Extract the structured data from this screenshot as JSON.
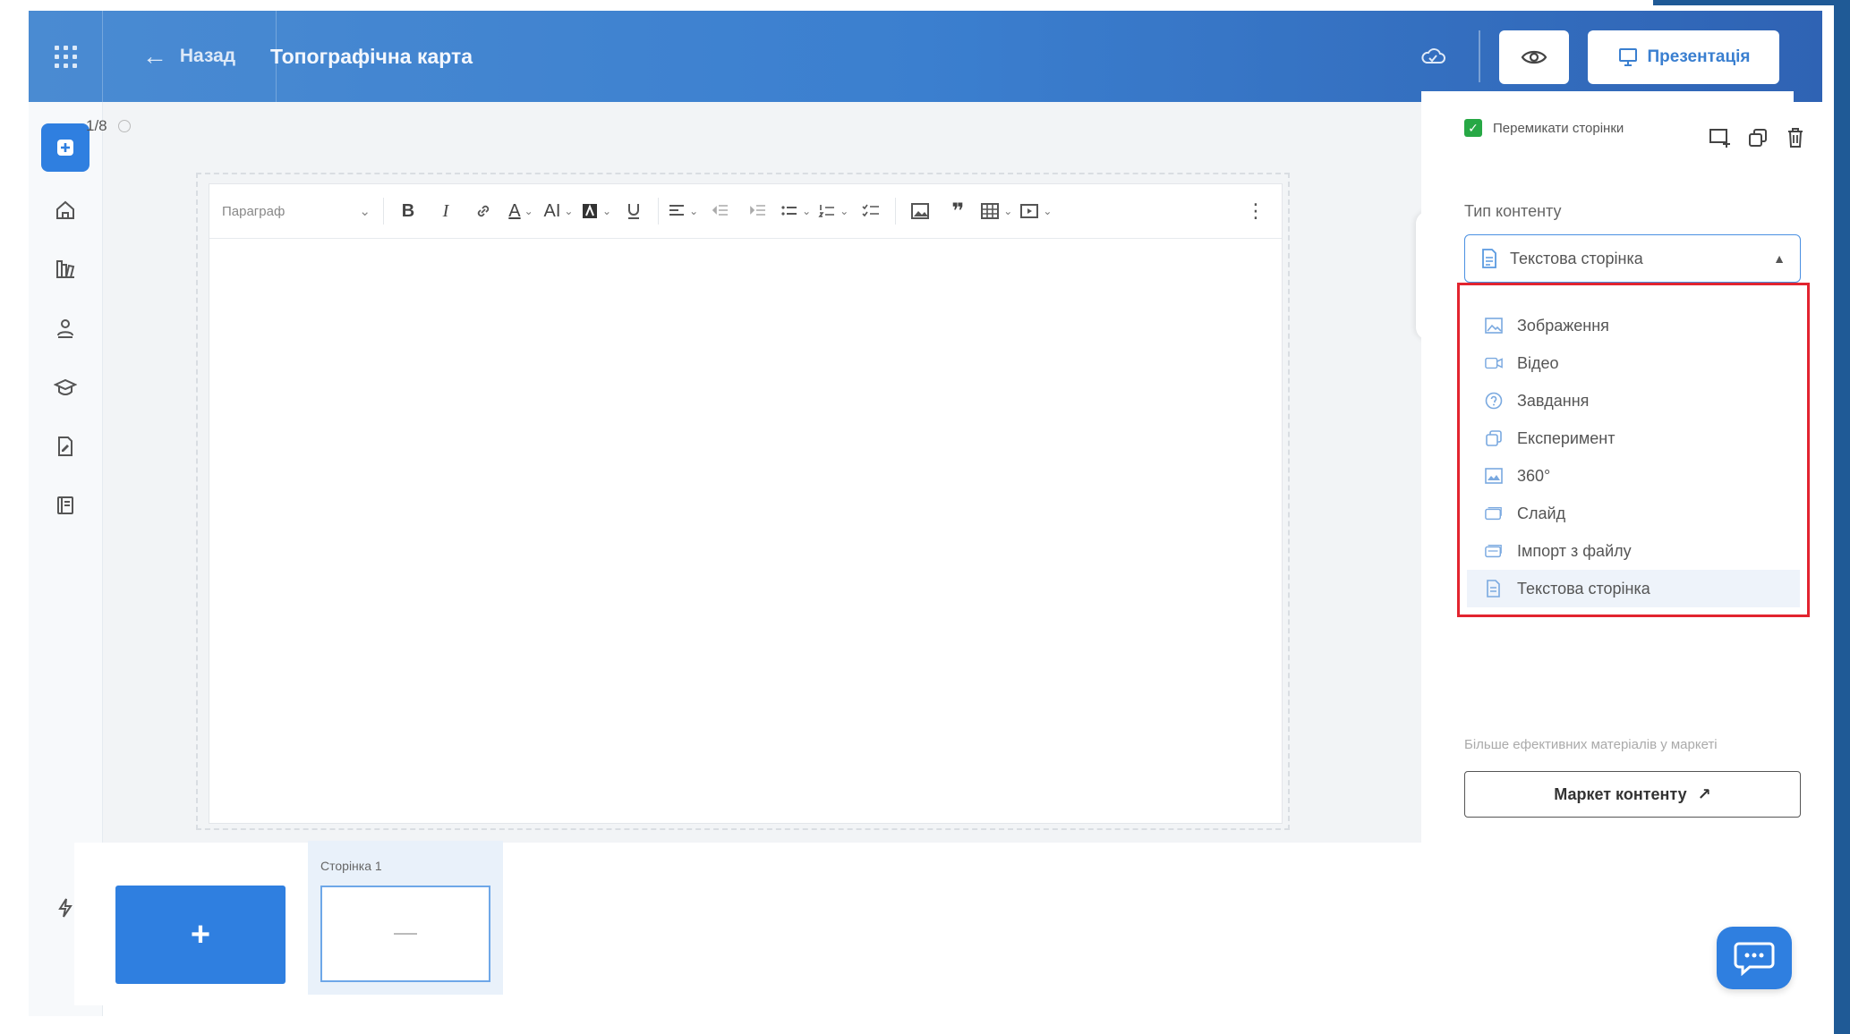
{
  "header": {
    "back_label": "Назад",
    "title": "Топографічна карта",
    "presentation_label": "Презентація"
  },
  "page_counter": "1/8",
  "toolbar": {
    "paragraph_label": "Параграф",
    "buttons": [
      "B",
      "I",
      "A",
      "AI"
    ]
  },
  "right_panel": {
    "switch_pages_label": "Перемикати сторінки",
    "content_type_label": "Тип контенту",
    "selected_type": "Текстова сторінка",
    "options": [
      {
        "label": "Зображення",
        "icon": "image-icon"
      },
      {
        "label": "Відео",
        "icon": "video-icon"
      },
      {
        "label": "Завдання",
        "icon": "question-icon"
      },
      {
        "label": "Експеримент",
        "icon": "experiment-icon"
      },
      {
        "label": "360°",
        "icon": "panorama-icon"
      },
      {
        "label": "Слайд",
        "icon": "slide-icon"
      },
      {
        "label": "Імпорт з файлу",
        "icon": "import-icon"
      },
      {
        "label": "Текстова сторінка",
        "icon": "text-page-icon"
      }
    ],
    "market_hint": "Більше ефективних матеріалів у маркеті",
    "market_button": "Маркет контенту"
  },
  "pages": {
    "add_label": "+",
    "thumbnails": [
      {
        "label": "Сторінка 1"
      }
    ]
  },
  "colors": {
    "header_start": "#4a8bd2",
    "header_end": "#2f63b4",
    "accent": "#2f7fe0",
    "dropdown_highlight": "#e2242f",
    "checkbox": "#27a845"
  }
}
